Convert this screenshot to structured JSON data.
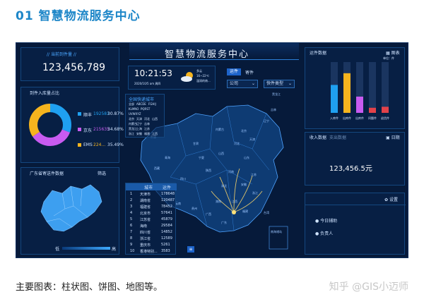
{
  "page": {
    "heading": "01 智慧物流服务中心",
    "caption": "主要图表：柱状图、饼图、地图等。",
    "watermark": "知乎 @GIS小迈师"
  },
  "dashboard": {
    "title": "智慧物流服务中心",
    "total_card": {
      "label": "// 当前到件量 //",
      "value": "123,456,789"
    },
    "pie_panel": {
      "title": "到件入库量占比",
      "legend": [
        {
          "name": "顺丰",
          "value": "192581",
          "pct": "30.87%",
          "color": "#1fa0f0"
        },
        {
          "name": "京东",
          "value": "215635",
          "pct": "34.68%",
          "color": "#c85bf0"
        },
        {
          "name": "EMS",
          "value": "224...",
          "pct": "35.49%",
          "color": "#f5b41e"
        }
      ]
    },
    "gd_panel": {
      "title": "广东省寄送件数据",
      "filter_label": "筛选",
      "scale_low": "低",
      "scale_high": "高"
    },
    "clock": {
      "time": "10:21:53",
      "date": "2020/10/5  am 周四",
      "weather_label": "多云",
      "weather_temp": "16~22℃",
      "weather_extra": "湿润的南..."
    },
    "controls": {
      "tab_active": "运件",
      "tab_other": "寄件",
      "company_select": "公司",
      "type_select": "快件类型"
    },
    "city_filter": {
      "title": "全国快递城市",
      "rows": [
        [
          "全部",
          "ABCDE",
          "FGHIJ"
        ],
        [
          "KLMNO",
          "PQRST"
        ],
        [
          "UVWXYZ"
        ],
        [
          "北京",
          "天津",
          "河北",
          "山西"
        ],
        [
          "内蒙古",
          "辽宁",
          "吉林"
        ],
        [
          "黑龙江",
          "上海",
          "江苏"
        ],
        [
          "浙江",
          "安徽",
          "福建",
          "江西"
        ]
      ]
    },
    "city_table": {
      "headers": [
        "城市",
        "运件"
      ],
      "rows": [
        [
          "1",
          "天津市",
          "178648"
        ],
        [
          "2",
          "湖南省",
          "120487"
        ],
        [
          "3",
          "福建省",
          "78452"
        ],
        [
          "4",
          "北京市",
          "57641"
        ],
        [
          "5",
          "江苏省",
          "45879"
        ],
        [
          "6",
          "海南",
          "29584"
        ],
        [
          "7",
          "四川省",
          "14852"
        ],
        [
          "8",
          "浙江省",
          "12589"
        ],
        [
          "9",
          "重庆市",
          "5261"
        ],
        [
          "10",
          "香港特别...",
          "3583"
        ]
      ]
    },
    "map_labels": [
      "新疆",
      "西藏",
      "青海",
      "甘肃",
      "四川",
      "云南",
      "贵州",
      "广西",
      "广东",
      "湖南",
      "湖北",
      "河南",
      "山东",
      "江苏",
      "浙江",
      "福建",
      "江西",
      "安徽",
      "北京",
      "天津",
      "河北",
      "山西",
      "陕西",
      "宁夏",
      "内蒙古",
      "辽宁",
      "吉林",
      "黑龙江",
      "台湾",
      "南海诸岛"
    ],
    "bar_panel": {
      "title": "运件数据",
      "icon_label": "图表",
      "unit_label": "单位：件",
      "chart_data": {
        "type": "bar",
        "categories": [
          "入库件",
          "出库件",
          "出库件",
          "问题件",
          "退货件"
        ],
        "series": [
          {
            "values": [
              55,
              78,
              32,
              10,
              12
            ]
          }
        ],
        "colors": [
          "#1fa0f0",
          "#f5b41e",
          "#c85bf0",
          "#e2424a",
          "#e2424a"
        ],
        "ylim": [
          0,
          100
        ]
      }
    },
    "income_panel": {
      "title_active": "收入数据",
      "title_other": "支出数据",
      "icon_label": "日期",
      "value": "123,456.5元"
    },
    "settings_panel": {
      "icon_label": "设置",
      "items": [
        "今日辅助",
        "负责人"
      ]
    }
  }
}
